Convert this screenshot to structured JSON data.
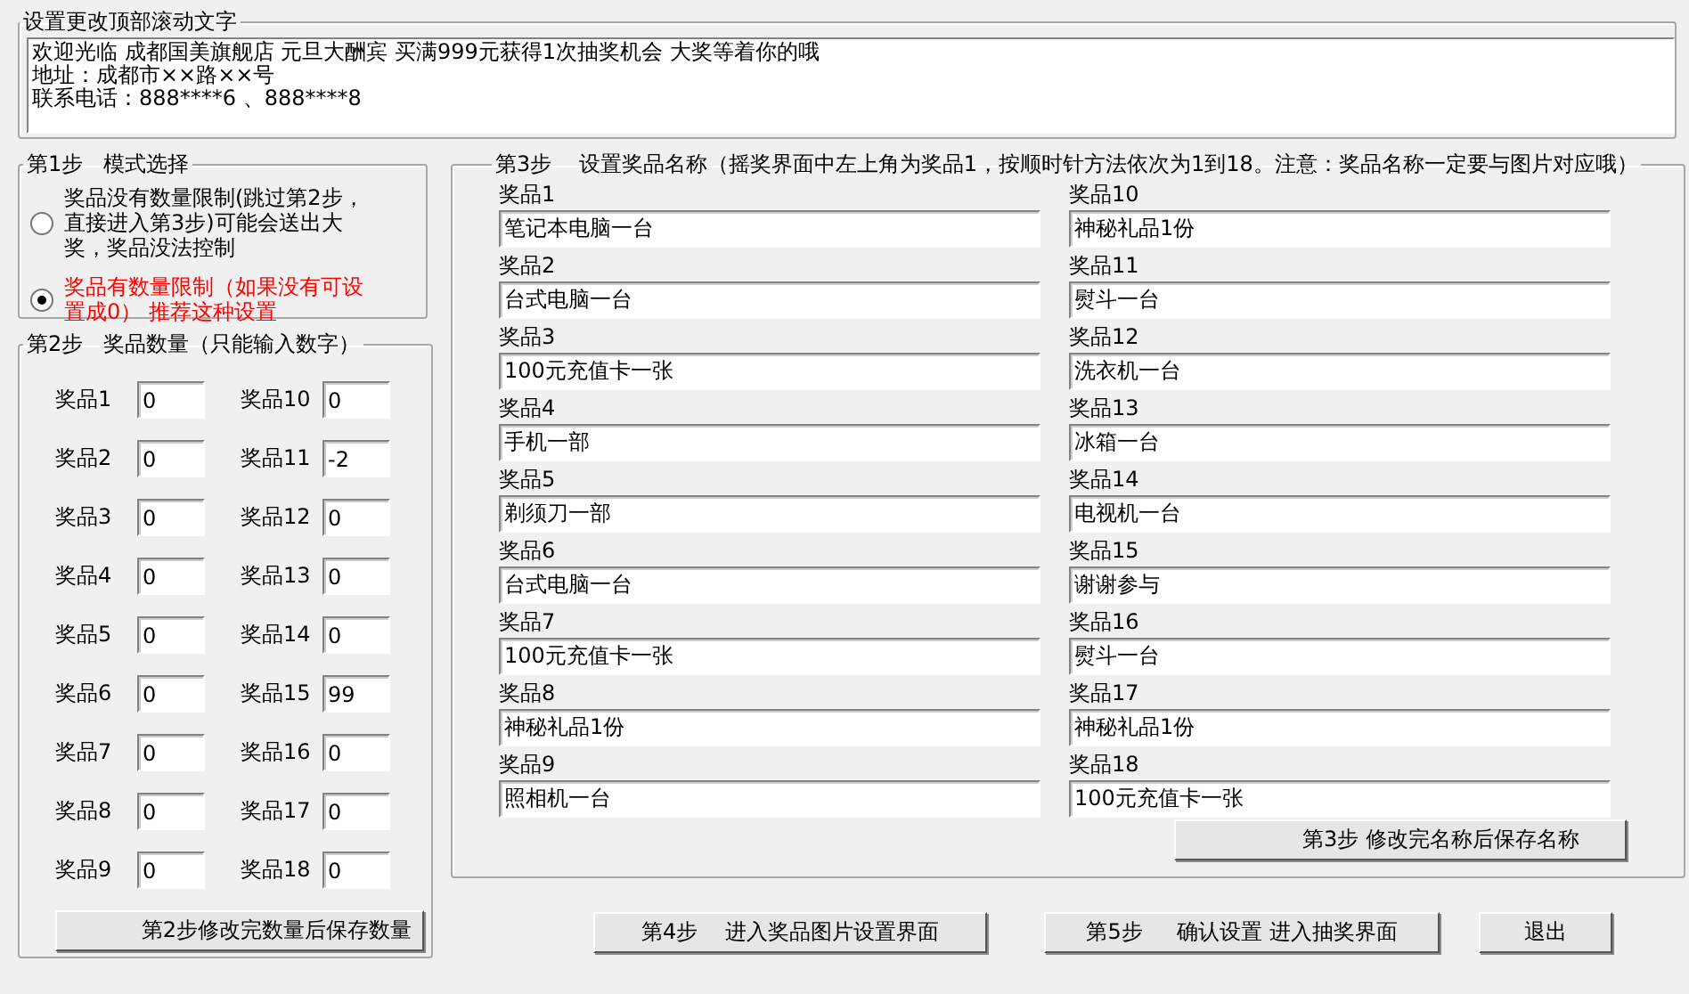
{
  "marquee": {
    "title": "设置更改顶部滚动文字",
    "lines": [
      "欢迎光临 成都国美旗舰店 元旦大酬宾 买满999元获得1次抽奖机会 大奖等着你的哦",
      "地址：成都市××路××号",
      "联系电话：888****6 、888****8"
    ]
  },
  "step1": {
    "title": "第1步   模式选择",
    "options": [
      {
        "label": "奖品没有数量限制(跳过第2步，直接进入第3步)可能会送出大奖，奖品没法控制",
        "selected": false,
        "color": "#000000"
      },
      {
        "label": "奖品有数量限制（如果没有可设置成0） 推荐这种设置",
        "selected": true,
        "color": "#ff0000"
      }
    ]
  },
  "step2": {
    "title": "第2步   奖品数量（只能输入数字）",
    "items": [
      {
        "label": "奖品1",
        "value": "0"
      },
      {
        "label": "奖品2",
        "value": "0"
      },
      {
        "label": "奖品3",
        "value": "0"
      },
      {
        "label": "奖品4",
        "value": "0"
      },
      {
        "label": "奖品5",
        "value": "0"
      },
      {
        "label": "奖品6",
        "value": "0"
      },
      {
        "label": "奖品7",
        "value": "0"
      },
      {
        "label": "奖品8",
        "value": "0"
      },
      {
        "label": "奖品9",
        "value": "0"
      },
      {
        "label": "奖品10",
        "value": "0"
      },
      {
        "label": "奖品11",
        "value": "-2"
      },
      {
        "label": "奖品12",
        "value": "0"
      },
      {
        "label": "奖品13",
        "value": "0"
      },
      {
        "label": "奖品14",
        "value": "0"
      },
      {
        "label": "奖品15",
        "value": "99"
      },
      {
        "label": "奖品16",
        "value": "0"
      },
      {
        "label": "奖品17",
        "value": "0"
      },
      {
        "label": "奖品18",
        "value": "0"
      }
    ],
    "save_button": "第2步修改完数量后保存数量"
  },
  "step3": {
    "title": "第3步    设置奖品名称（摇奖界面中左上角为奖品1，按顺时针方法依次为1到18。注意：奖品名称一定要与图片对应哦）",
    "items": [
      {
        "label": "奖品1",
        "value": "笔记本电脑一台"
      },
      {
        "label": "奖品2",
        "value": "台式电脑一台"
      },
      {
        "label": "奖品3",
        "value": "100元充值卡一张"
      },
      {
        "label": "奖品4",
        "value": "手机一部"
      },
      {
        "label": "奖品5",
        "value": "剃须刀一部"
      },
      {
        "label": "奖品6",
        "value": "台式电脑一台"
      },
      {
        "label": "奖品7",
        "value": "100元充值卡一张"
      },
      {
        "label": "奖品8",
        "value": "神秘礼品1份"
      },
      {
        "label": "奖品9",
        "value": "照相机一台"
      },
      {
        "label": "奖品10",
        "value": "神秘礼品1份"
      },
      {
        "label": "奖品11",
        "value": "熨斗一台"
      },
      {
        "label": "奖品12",
        "value": "洗衣机一台"
      },
      {
        "label": "奖品13",
        "value": "冰箱一台"
      },
      {
        "label": "奖品14",
        "value": "电视机一台"
      },
      {
        "label": "奖品15",
        "value": "谢谢参与"
      },
      {
        "label": "奖品16",
        "value": "熨斗一台"
      },
      {
        "label": "奖品17",
        "value": "神秘礼品1份"
      },
      {
        "label": "奖品18",
        "value": "100元充值卡一张"
      }
    ],
    "save_button": "第3步 修改完名称后保存名称"
  },
  "buttons": [
    "第4步    进入奖品图片设置界面",
    "第5步     确认设置 进入抽奖界面",
    "退出"
  ]
}
